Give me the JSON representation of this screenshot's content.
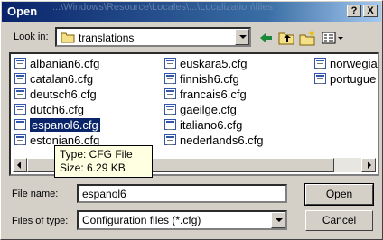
{
  "title": "Open",
  "background_path": "...\\Windows\\Resource\\Locales\\...\\Localization\\files",
  "title_buttons": {
    "help": "?",
    "close": "X"
  },
  "look_in": {
    "label": "Look in:",
    "value": "translations"
  },
  "files": [
    {
      "name": "albanian6.cfg"
    },
    {
      "name": "catalan6.cfg"
    },
    {
      "name": "deutsch6.cfg"
    },
    {
      "name": "dutch6.cfg"
    },
    {
      "name": "espanol6.cfg",
      "selected": true
    },
    {
      "name": "estonian6.cfg"
    },
    {
      "name": "euskara5.cfg"
    },
    {
      "name": "finnish6.cfg"
    },
    {
      "name": "francais6.cfg"
    },
    {
      "name": "gaeilge.cfg"
    },
    {
      "name": "italiano6.cfg"
    },
    {
      "name": "nederlands6.cfg"
    },
    {
      "name": "norwegia"
    },
    {
      "name": "portugue"
    }
  ],
  "tooltip": {
    "type_line": "Type: CFG File",
    "size_line": "Size: 6.29 KB"
  },
  "file_name": {
    "label": "File name:",
    "value": "espanol6"
  },
  "files_of_type": {
    "label": "Files of type:",
    "value": "Configuration files (*.cfg)"
  },
  "buttons": {
    "open": "Open",
    "cancel": "Cancel"
  },
  "colors": {
    "title_active": "#0a246a",
    "selection": "#0a246a",
    "tooltip_bg": "#ffffe1",
    "face": "#d4d0c8"
  }
}
